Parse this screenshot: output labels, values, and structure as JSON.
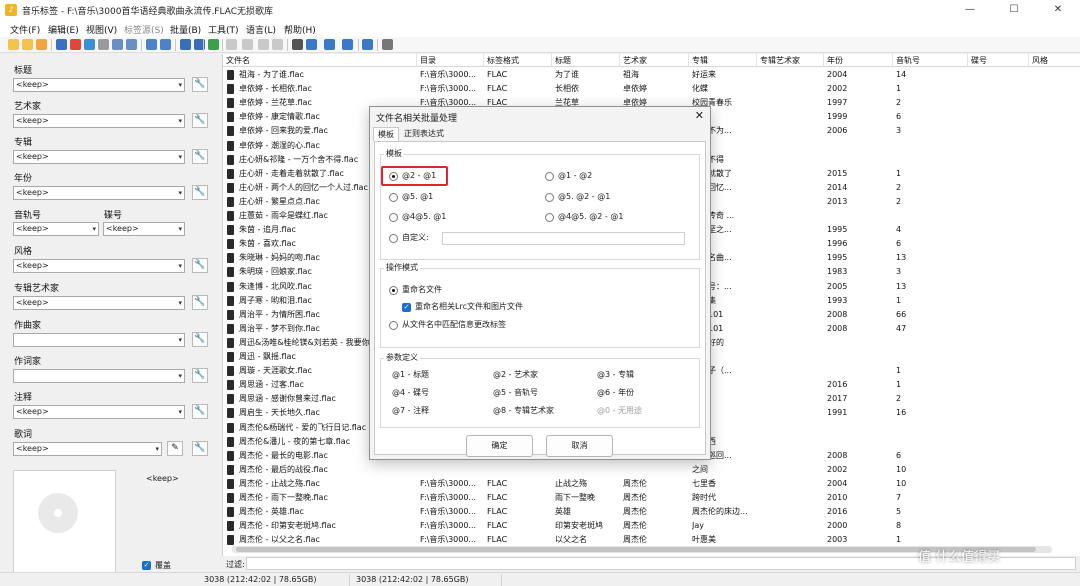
{
  "window": {
    "title": "音乐标签 - F:\\音乐\\3000首华语经典歌曲永流传.FLAC无损歌库",
    "controls": [
      "—",
      "☐",
      "✕"
    ]
  },
  "menu": [
    {
      "label": "文件(F)",
      "disabled": false
    },
    {
      "label": "编辑(E)",
      "disabled": false
    },
    {
      "label": "视图(V)",
      "disabled": false
    },
    {
      "label": "标签源(S)",
      "disabled": true
    },
    {
      "label": "批量(B)",
      "disabled": false
    },
    {
      "label": "工具(T)",
      "disabled": false
    },
    {
      "label": "语言(L)",
      "disabled": false
    },
    {
      "label": "帮助(H)",
      "disabled": false
    }
  ],
  "left_panel": {
    "fields": [
      {
        "label": "标题",
        "value": "<keep>"
      },
      {
        "label": "艺术家",
        "value": "<keep>"
      },
      {
        "label": "专辑",
        "value": "<keep>"
      },
      {
        "label": "年份",
        "value": "<keep>"
      },
      {
        "label": "风格",
        "value": "<keep>"
      },
      {
        "label": "专辑艺术家",
        "value": "<keep>"
      },
      {
        "label": "作曲家",
        "value": ""
      },
      {
        "label": "作词家",
        "value": ""
      },
      {
        "label": "注释",
        "value": "<keep>"
      },
      {
        "label": "歌词",
        "value": "<keep>"
      }
    ],
    "track": {
      "label": "音轨号",
      "value": "<keep>"
    },
    "disc": {
      "label": "碟号",
      "value": "<keep>"
    },
    "cover_label": "<keep>",
    "overwrite_label": "覆盖"
  },
  "table": {
    "columns": [
      "文件名",
      "目录",
      "标签格式",
      "标题",
      "艺术家",
      "专辑",
      "专辑艺术家",
      "年份",
      "音轨号",
      "碟号",
      "风格"
    ],
    "rows": [
      [
        "祖海 - 为了谁.flac",
        "F:\\音乐\\3000...",
        "FLAC",
        "为了谁",
        "祖海",
        "好运来",
        "",
        "2004",
        "14"
      ],
      [
        "卓依婷 - 长相依.flac",
        "F:\\音乐\\3000...",
        "FLAC",
        "长相依",
        "卓依婷",
        "化蝶",
        "",
        "2002",
        "1"
      ],
      [
        "卓依婷 - 兰花草.flac",
        "F:\\音乐\\3000...",
        "FLAC",
        "兰花草",
        "卓依婷",
        "校园青春乐",
        "",
        "1997",
        "2"
      ],
      [
        "卓依婷 - 康定情歌.flac",
        "",
        "",
        "",
        "",
        "",
        "",
        "1999",
        "6"
      ],
      [
        "卓依婷 - 回来我的爱.flac",
        "",
        "",
        "",
        "",
        "来泪不为...",
        "",
        "2006",
        "3"
      ],
      [
        "卓依婷 - 潮湿的心.flac",
        "",
        "",
        "",
        "",
        "事Ⅰ",
        "",
        "",
        ""
      ],
      [
        "庄心妍&祁隆 - 一万个舍不得.flac",
        "",
        "",
        "",
        "",
        "个舍不得",
        "",
        "",
        ""
      ],
      [
        "庄心妍 - 走着走着就散了.flac",
        "",
        "",
        "",
        "",
        "走着就散了",
        "",
        "2015",
        "1"
      ],
      [
        "庄心妍 - 两个人的回忆一个人过.flac",
        "",
        "",
        "",
        "",
        "人的回忆...",
        "",
        "2014",
        "2"
      ],
      [
        "庄心妍 - 繁星点点.flac",
        "",
        "",
        "",
        "",
        "点点",
        "",
        "2013",
        "2"
      ],
      [
        "庄蕙茹 - 雨伞是蝶红.flac",
        "",
        "",
        "",
        "",
        "才子传奇 ...",
        "",
        "",
        ""
      ],
      [
        "朱茵 - 追月.flac",
        "",
        "",
        "",
        "",
        "四大至之...",
        "",
        "1995",
        "4"
      ],
      [
        "朱茵 - 喜欢.flac",
        "",
        "",
        "",
        "",
        "",
        "",
        "1996",
        "6"
      ],
      [
        "朱晓琳 - 妈妈的吻.flac",
        "",
        "",
        "",
        "",
        "经典名曲...",
        "",
        "1995",
        "13"
      ],
      [
        "朱明瑛 - 回娘家.flac",
        "",
        "",
        "",
        "",
        "家",
        "",
        "1983",
        "3"
      ],
      [
        "朱逢博 - 北风吹.flac",
        "",
        "",
        "",
        "",
        "的符号：...",
        "",
        "2005",
        "13"
      ],
      [
        "周子寒 - 哟和泪.flac",
        "",
        "",
        "",
        "",
        "精选集",
        "",
        "1993",
        "1"
      ],
      [
        "周治平 - 为情所困.flac",
        "",
        "",
        "",
        "",
        "经典101",
        "",
        "2008",
        "66"
      ],
      [
        "周治平 - 梦不到你.flac",
        "",
        "",
        "",
        "",
        "经典101",
        "",
        "2008",
        "47"
      ],
      [
        "周迅&汤唯&桂纶镁&刘若英 - 我要你...",
        "",
        "",
        "",
        "",
        "你好好的",
        "",
        "",
        ""
      ],
      [
        "周迅 - 飘摇.flac",
        "",
        "",
        "",
        "",
        "",
        "",
        "",
        ""
      ],
      [
        "周璇 - 天涯歌女.flac",
        "",
        "",
        "",
        "",
        "金嗓子（...",
        "",
        "",
        "1"
      ],
      [
        "周思涵 - 过客.flac",
        "",
        "",
        "",
        "",
        "",
        "",
        "2016",
        "1"
      ],
      [
        "周思涵 - 感谢你曾来过.flac",
        "",
        "",
        "",
        "",
        "与酒",
        "",
        "2017",
        "2"
      ],
      [
        "周启生 - 天长地久.flac",
        "",
        "",
        "",
        "",
        "一天",
        "",
        "1991",
        "16"
      ],
      [
        "周杰伦&杨瑞代 - 爱的飞行日记.flac",
        "",
        "",
        "",
        "",
        "",
        "",
        "",
        ""
      ],
      [
        "周杰伦&潘儿 - 夜的第七章.flac",
        "",
        "",
        "",
        "",
        "摩特西",
        "",
        "",
        ""
      ],
      [
        "周杰伦 - 最长的电影.flac",
        "",
        "",
        "",
        "",
        "世界巡回...",
        "",
        "2008",
        "6"
      ],
      [
        "周杰伦 - 最后的战役.flac",
        "",
        "",
        "",
        "",
        "之间",
        "",
        "2002",
        "10"
      ],
      [
        "周杰伦 - 止战之殇.flac",
        "F:\\音乐\\3000...",
        "FLAC",
        "止战之殇",
        "周杰伦",
        "七里香",
        "",
        "2004",
        "10"
      ],
      [
        "周杰伦 - 雨下一整晚.flac",
        "F:\\音乐\\3000...",
        "FLAC",
        "雨下一整晚",
        "周杰伦",
        "跨时代",
        "",
        "2010",
        "7"
      ],
      [
        "周杰伦 - 英雄.flac",
        "F:\\音乐\\3000...",
        "FLAC",
        "英雄",
        "周杰伦",
        "周杰伦的床边...",
        "",
        "2016",
        "5"
      ],
      [
        "周杰伦 - 印第安老斑鸠.flac",
        "F:\\音乐\\3000...",
        "FLAC",
        "印第安老斑鸠",
        "周杰伦",
        "Jay",
        "",
        "2000",
        "8"
      ],
      [
        "周杰伦 - 以父之名.flac",
        "F:\\音乐\\3000...",
        "FLAC",
        "以父之名",
        "周杰伦",
        "叶惠美",
        "",
        "2003",
        "1"
      ]
    ]
  },
  "filter": {
    "label": "过滤:",
    "value": ""
  },
  "status": [
    "3038 (212:42:02 | 78.65GB)",
    "3038 (212:42:02 | 78.65GB)"
  ],
  "dialog": {
    "title": "文件名相关批量处理",
    "close": "✕",
    "tabs": [
      "模板",
      "正则表达式"
    ],
    "template_group": "模板",
    "template_options": [
      "@2 - @1",
      "@1 - @2",
      "@5. @1",
      "@5. @2 - @1",
      "@4@5. @1",
      "@4@5. @2 - @1"
    ],
    "custom_label": "自定义:",
    "custom_value": "",
    "mode_group": "操作模式",
    "mode_rename": "重命名文件",
    "mode_rename_lrc": "重命名相关Lrc文件和图片文件",
    "mode_from_name": "从文件名中匹配信息更改标签",
    "params_group": "参数定义",
    "params": [
      "@1 - 标题",
      "@2 - 艺术家",
      "@3 - 专辑",
      "@4 - 碟号",
      "@5 - 音轨号",
      "@6 - 年份",
      "@7 - 注释",
      "@8 - 专辑艺术家",
      "@0 - 无用途"
    ],
    "ok": "确定",
    "cancel": "取消"
  },
  "watermark": "值 什么值得买",
  "colors": {
    "highlight": "#e0262a",
    "checkbox": "#1a6fd0"
  }
}
